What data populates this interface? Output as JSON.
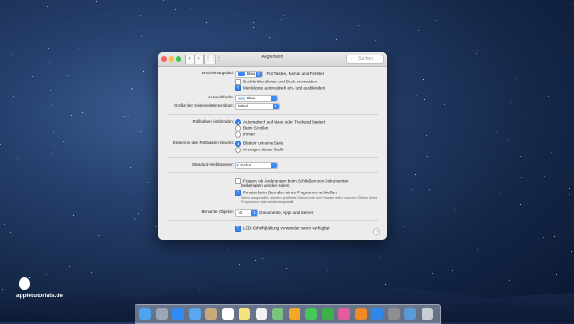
{
  "window": {
    "title": "Allgemein",
    "search_placeholder": "Suchen",
    "nav_back": "‹",
    "nav_forward": "›",
    "grid_icon": "⋮⋮⋮"
  },
  "settings": {
    "appearance": {
      "label": "Erscheinungsbild:",
      "value": "Blau",
      "hint": "Für Tasten, Menüs und Fenster",
      "swatch_color": "#3a86f6"
    },
    "dark_menu": {
      "label": "Dunkle Menüleiste und Dock verwenden",
      "checked": false
    },
    "auto_hide_menu": {
      "label": "Menüleiste automatisch ein- und ausblenden",
      "checked": true
    },
    "highlight": {
      "label": "Auswahlfarbe:",
      "value": "Blau",
      "swatch_color": "#b4d2f8"
    },
    "sidebar_icon_size": {
      "label": "Größe der Seitenleistensymbole:",
      "value": "Mittel"
    },
    "scrollbars": {
      "label": "Rollbalken einblenden:",
      "options": [
        "Automatisch auf Maus oder Trackpad basiert",
        "Beim Scrollen",
        "Immer"
      ],
      "selected": 0
    },
    "click_scrollbar": {
      "label": "Klicken in den Rollbalken bewirkt:",
      "options": [
        "Blättern um eine Seite",
        "Anzeigen dieser Stelle"
      ],
      "selected": 0
    },
    "default_browser": {
      "label": "Standard-Webbrowser:",
      "value": "Safari"
    },
    "ask_keep_changes": {
      "label_line1": "Fragen, ob Änderungen beim Schließen von Dokumenten",
      "label_line2": "beibehalten werden sollen",
      "checked": false
    },
    "close_windows": {
      "label": "Fenster beim Beenden eines Programms schließen",
      "checked": true
    },
    "close_windows_note_line1": "Wenn ausgewählt, werden geöffnete Dokumente und Fenster beim erneuten Öffnen eines",
    "close_windows_note_line2": "Programms nicht wiederhergestellt.",
    "recent_items": {
      "label": "Benutzte Objekte:",
      "value": "10",
      "suffix": "Dokumente, Apps und Server"
    },
    "lcd_smoothing": {
      "label": "LCD-Schriftglättung verwenden wenn verfügbar",
      "checked": true
    },
    "help_label": "?"
  },
  "brand": {
    "name": "appletutorials.de"
  },
  "dock": {
    "items": [
      "finder-icon",
      "launchpad-icon",
      "safari-icon",
      "mail-icon",
      "contacts-icon",
      "calendar-icon",
      "notes-icon",
      "reminders-icon",
      "maps-icon",
      "photos-icon",
      "messages-icon",
      "facetime-icon",
      "itunes-icon",
      "ibooks-icon",
      "appstore-icon",
      "system-preferences-icon",
      "downloads-icon",
      "trash-icon"
    ],
    "colors": [
      "#4ea3f1",
      "#9aa7b8",
      "#2e8df5",
      "#5aa6ef",
      "#c8a97a",
      "#ffffff",
      "#f6e37c",
      "#f2f2f2",
      "#7bc47f",
      "#f5a623",
      "#47c75a",
      "#3cb14a",
      "#e35d9c",
      "#f08a24",
      "#2f88e8",
      "#8e8e93",
      "#5b9bd5",
      "#c9ced6"
    ]
  }
}
